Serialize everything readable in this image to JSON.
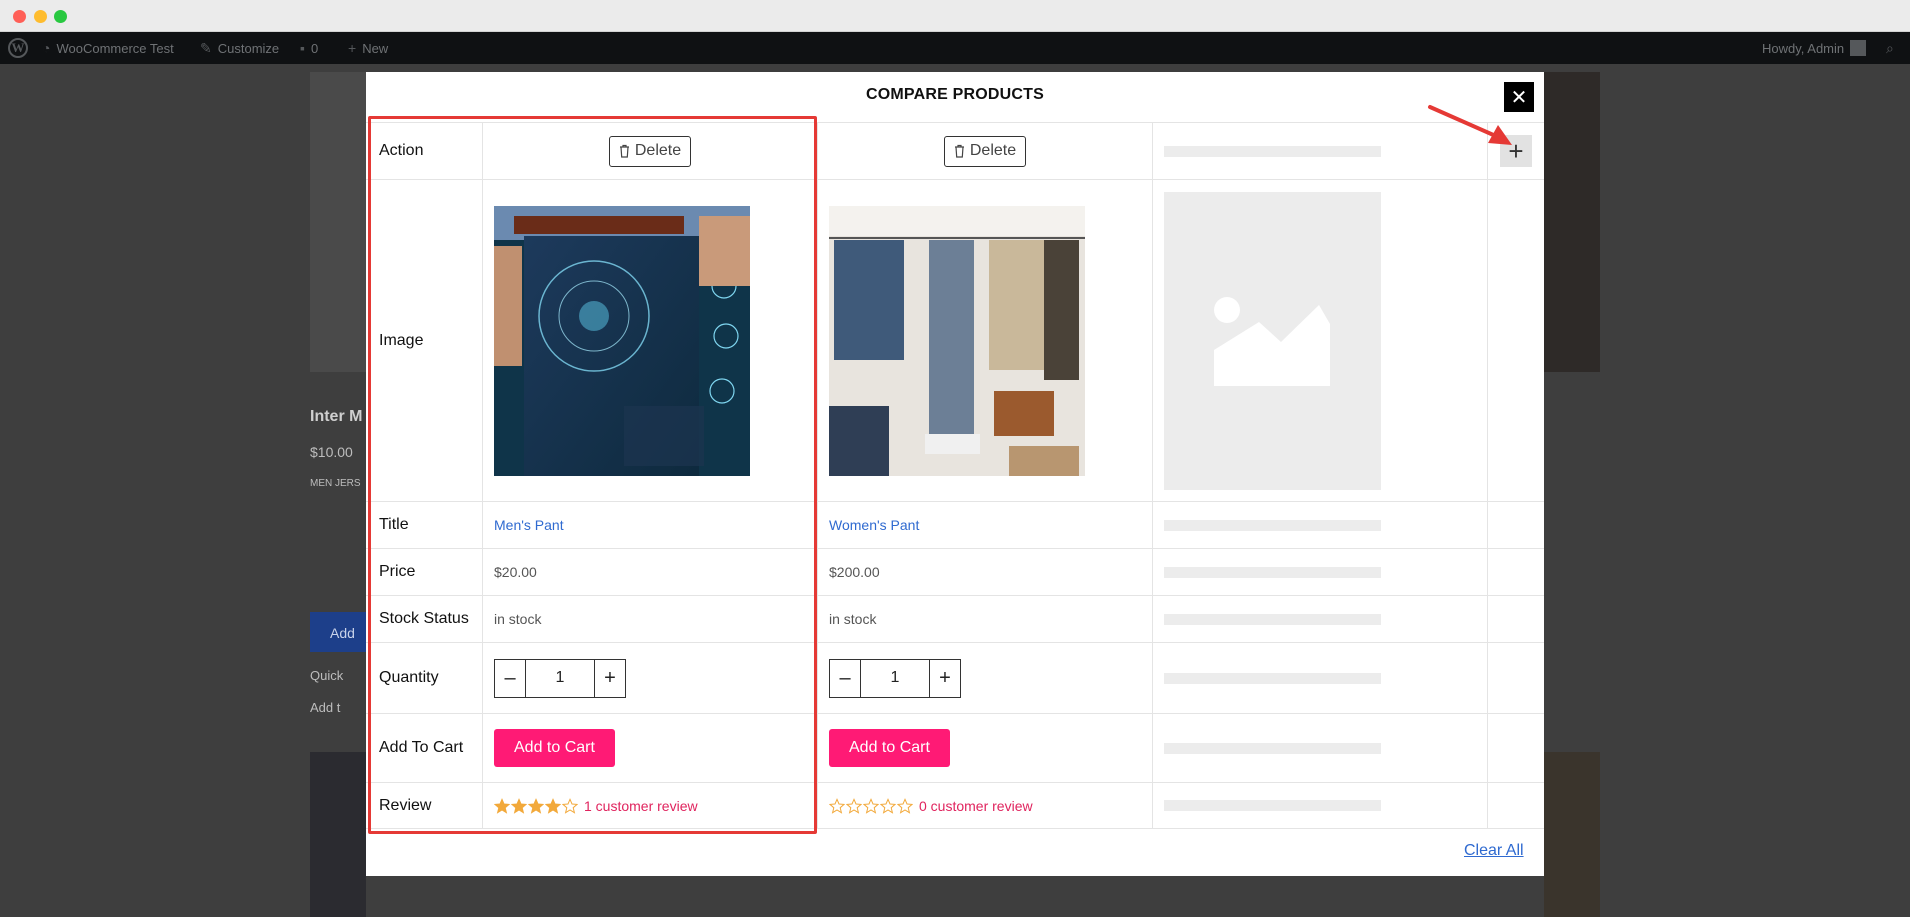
{
  "adminbar": {
    "site_name": "WooCommerce Test",
    "customize": "Customize",
    "comments_count": "0",
    "new_label": "New",
    "howdy": "Howdy, Admin"
  },
  "background": {
    "product_title_partial": "Inter M",
    "product_price": "$10.00",
    "product_category_partial": "MEN JERS",
    "add_btn_partial": "Add",
    "quick_partial": "Quick",
    "add_to_partial": "Add t"
  },
  "modal": {
    "title": "COMPARE PRODUCTS",
    "clear_all": "Clear All",
    "labels": {
      "action": "Action",
      "image": "Image",
      "title": "Title",
      "price": "Price",
      "stock": "Stock Status",
      "quantity": "Quantity",
      "add_to_cart": "Add To Cart",
      "review": "Review"
    },
    "products": [
      {
        "delete_label": "Delete",
        "title": "Men's Pant",
        "price": "$20.00",
        "stock": "in stock",
        "quantity": "1",
        "cart_label": "Add to Cart",
        "rating": 4,
        "review_text": "1 customer review"
      },
      {
        "delete_label": "Delete",
        "title": "Women's Pant",
        "price": "$200.00",
        "stock": "in stock",
        "quantity": "1",
        "cart_label": "Add to Cart",
        "rating": 0,
        "review_text": "0 customer review"
      }
    ]
  },
  "colors": {
    "cart_button": "#ff1a75",
    "link": "#2f6ad0",
    "review_link": "#e0245e",
    "star": "#f2a93b",
    "highlight": "#e53935"
  }
}
